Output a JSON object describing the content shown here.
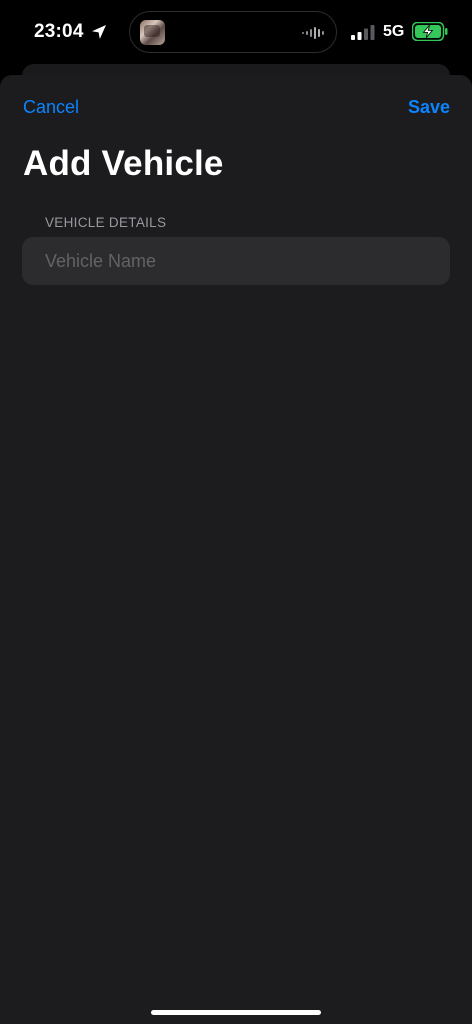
{
  "status_bar": {
    "time": "23:04",
    "network": "5G",
    "battery_color": "#34c759",
    "icons": [
      "location-arrow-icon",
      "album-artwork-icon",
      "waveform-icon",
      "signal-bars-icon",
      "battery-charging-icon"
    ]
  },
  "nav": {
    "cancel_label": "Cancel",
    "save_label": "Save",
    "accent_color": "#0a84ff"
  },
  "page": {
    "title": "Add Vehicle"
  },
  "form": {
    "section_header": "VEHICLE DETAILS",
    "vehicle_name": {
      "value": "",
      "placeholder": "Vehicle Name"
    }
  }
}
